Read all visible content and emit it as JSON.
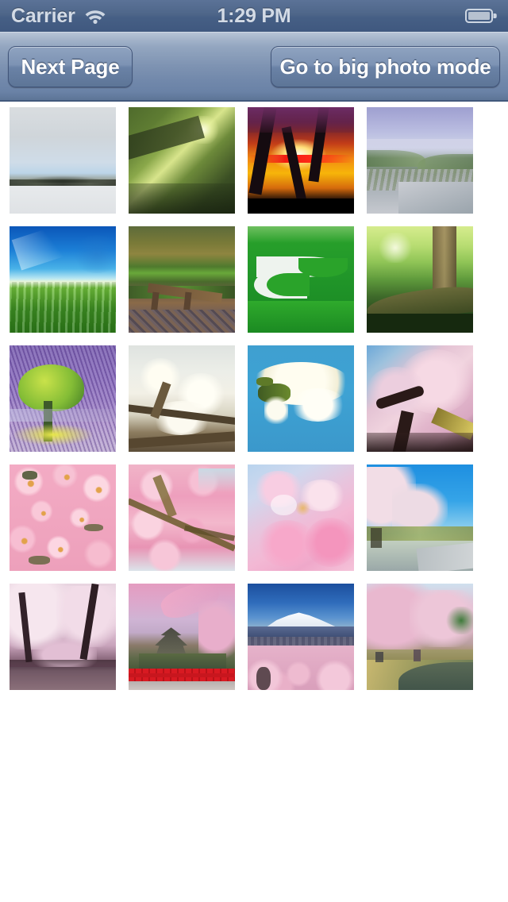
{
  "status_bar": {
    "carrier": "Carrier",
    "time": "1:29 PM",
    "wifi_icon": "wifi-icon",
    "battery_icon": "battery-icon",
    "background_color": "#4e6689",
    "text_color": "#d3dbe6"
  },
  "nav_bar": {
    "next_page_label": "Next Page",
    "big_photo_label": "Go to big photo mode",
    "background_color": "#7e93b2",
    "button_text_color": "#ffffff"
  },
  "grid": {
    "columns": 4,
    "rows": 5,
    "thumb_size_px": 134,
    "photos": [
      {
        "id": 1,
        "alt": "Snowy field with pine tree line under cloudy sky"
      },
      {
        "id": 2,
        "alt": "Sunlight through green tree canopy"
      },
      {
        "id": 3,
        "alt": "Orange sunset behind silhouetted blossom trees"
      },
      {
        "id": 4,
        "alt": "Misty lavender terraced hillsides"
      },
      {
        "id": 5,
        "alt": "Green crop field under deep blue sky"
      },
      {
        "id": 6,
        "alt": "Autumn forest path with wooden bridge"
      },
      {
        "id": 7,
        "alt": "White stream winding through bright green grass"
      },
      {
        "id": 8,
        "alt": "Sunlit forest with mossy fallen log"
      },
      {
        "id": 9,
        "alt": "Green tree standing in purple lavender field"
      },
      {
        "id": 10,
        "alt": "White blossoms on dark branches"
      },
      {
        "id": 11,
        "alt": "Cluster of white blossoms against blue sky"
      },
      {
        "id": 12,
        "alt": "Pink cherry blossoms viewed from below"
      },
      {
        "id": 13,
        "alt": "Dense pink cherry blossom close-up"
      },
      {
        "id": 14,
        "alt": "Pink blossoms with dark branches"
      },
      {
        "id": 15,
        "alt": "Soft focus pink blossoms on blue background"
      },
      {
        "id": 16,
        "alt": "Cherry tree avenue beside road under blue sky"
      },
      {
        "id": 17,
        "alt": "Cherry blossom tunnel over a path"
      },
      {
        "id": 18,
        "alt": "Japanese castle with red bridge and pink sky"
      },
      {
        "id": 19,
        "alt": "Snow capped mountain above cherry blossoms"
      },
      {
        "id": 20,
        "alt": "Cherry blossoms along a pond walkway"
      }
    ]
  }
}
